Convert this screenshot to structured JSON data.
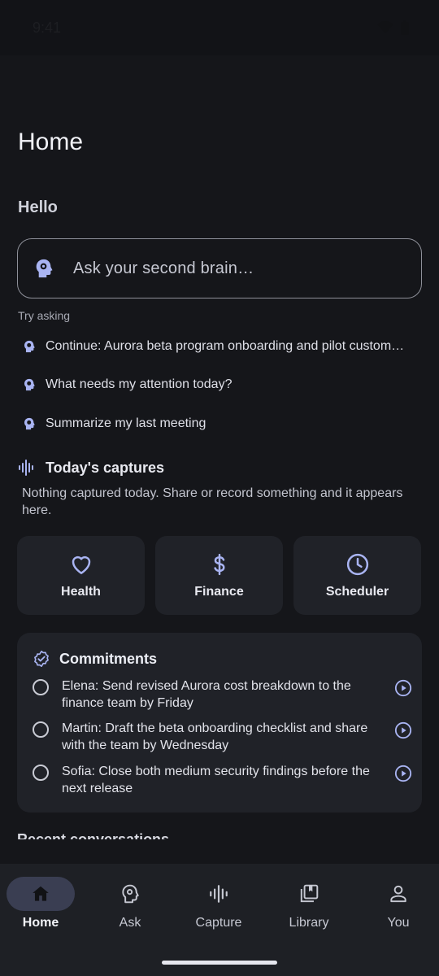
{
  "status_bar": {
    "time": "9:41"
  },
  "header": {
    "title": "Home",
    "greeting": "Hello"
  },
  "search": {
    "placeholder": "Ask your second brain…"
  },
  "try_asking": {
    "label": "Try asking",
    "suggestions": [
      "Continue: Aurora beta program onboarding and pilot custom…",
      "What needs my attention today?",
      "Summarize my last meeting"
    ]
  },
  "captures": {
    "title": "Today's captures",
    "empty_text": "Nothing captured today. Share or record something and it appears here."
  },
  "tiles": [
    {
      "label": "Health",
      "icon": "heart-icon"
    },
    {
      "label": "Finance",
      "icon": "dollar-icon"
    },
    {
      "label": "Scheduler",
      "icon": "clock-icon"
    }
  ],
  "commitments": {
    "title": "Commitments",
    "items": [
      "Elena: Send revised Aurora cost breakdown to the finance team by Friday",
      "Martin: Draft the beta onboarding checklist and share with the team by Wednesday",
      "Sofia: Close both medium security findings before the next release"
    ]
  },
  "recent": {
    "title": "Recent conversations"
  },
  "nav": {
    "items": [
      {
        "label": "Home",
        "icon": "home-icon",
        "active": true
      },
      {
        "label": "Ask",
        "icon": "brain-icon",
        "active": false
      },
      {
        "label": "Capture",
        "icon": "waveform-icon",
        "active": false
      },
      {
        "label": "Library",
        "icon": "library-icon",
        "active": false
      },
      {
        "label": "You",
        "icon": "person-icon",
        "active": false
      }
    ]
  },
  "colors": {
    "background": "#15161a",
    "card": "#202228",
    "accent": "#a9b4f2",
    "nav_active_pill": "#3a3e52"
  }
}
